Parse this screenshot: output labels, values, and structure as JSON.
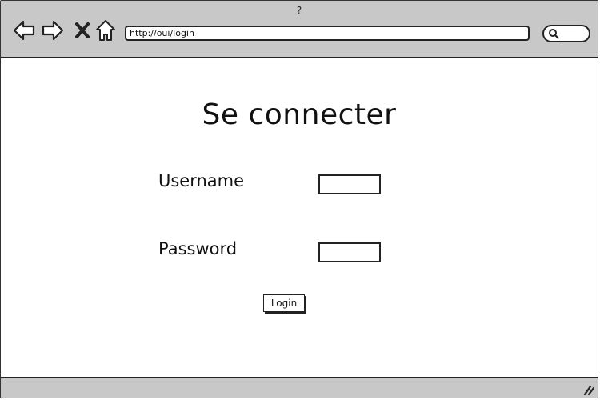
{
  "window": {
    "title": "?"
  },
  "toolbar": {
    "back_icon": "back-arrow-icon",
    "forward_icon": "forward-arrow-icon",
    "stop_icon": "close-x-icon",
    "home_icon": "home-icon",
    "address": "http://oui/login",
    "search_icon": "search-icon"
  },
  "form": {
    "title": "Se connecter",
    "username_label": "Username",
    "username_value": "",
    "password_label": "Password",
    "password_value": "",
    "login_label": "Login"
  },
  "colors": {
    "chrome": "#c8c8c8",
    "content": "#ffffff",
    "ink": "#222222"
  }
}
